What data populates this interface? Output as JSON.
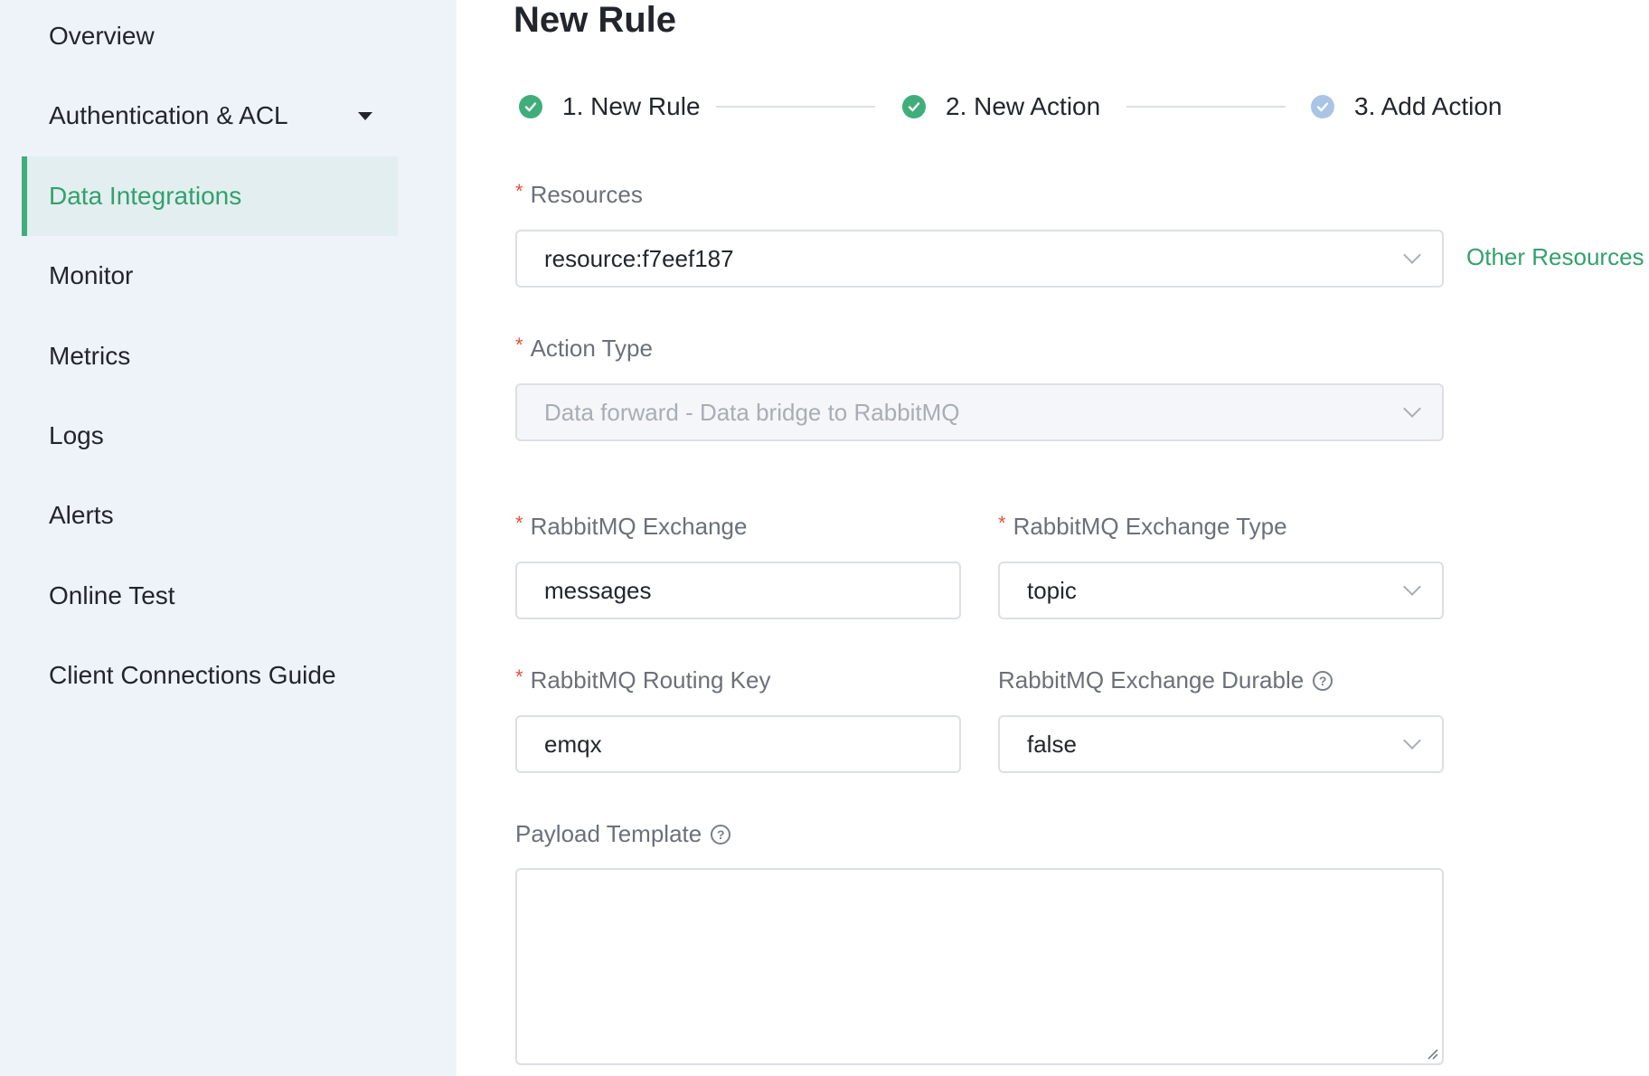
{
  "sidebar": {
    "items": [
      {
        "label": "Overview"
      },
      {
        "label": "Authentication & ACL"
      },
      {
        "label": "Data Integrations"
      },
      {
        "label": "Monitor"
      },
      {
        "label": "Metrics"
      },
      {
        "label": "Logs"
      },
      {
        "label": "Alerts"
      },
      {
        "label": "Online Test"
      },
      {
        "label": "Client Connections Guide"
      }
    ],
    "active_item": "Data Integrations"
  },
  "page": {
    "title": "New Rule"
  },
  "steps": [
    {
      "label": "1. New Rule",
      "status": "done"
    },
    {
      "label": "2. New Action",
      "status": "done"
    },
    {
      "label": "3. Add Action",
      "status": "pending"
    }
  ],
  "form": {
    "resources": {
      "label": "Resources",
      "value": "resource:f7eef187",
      "link": "Other Resources"
    },
    "action_type": {
      "label": "Action Type",
      "value": "Data forward - Data bridge to RabbitMQ"
    },
    "exchange": {
      "label": "RabbitMQ Exchange",
      "value": "messages"
    },
    "exchange_type": {
      "label": "RabbitMQ Exchange Type",
      "value": "topic"
    },
    "routing_key": {
      "label": "RabbitMQ Routing Key",
      "value": "emqx"
    },
    "exchange_durable": {
      "label": "RabbitMQ Exchange Durable",
      "value": "false"
    },
    "payload_template": {
      "label": "Payload Template",
      "value": ""
    }
  },
  "colors": {
    "accent": "#3fae7b",
    "sidebar_bg": "#eef2f9",
    "required": "#e0533c"
  },
  "icons": {
    "step_done": "check-circle-icon",
    "step_pending": "check-circle-icon",
    "help": "question-circle-icon",
    "dropdown": "chevron-down-icon",
    "submenu": "caret-down-icon"
  }
}
